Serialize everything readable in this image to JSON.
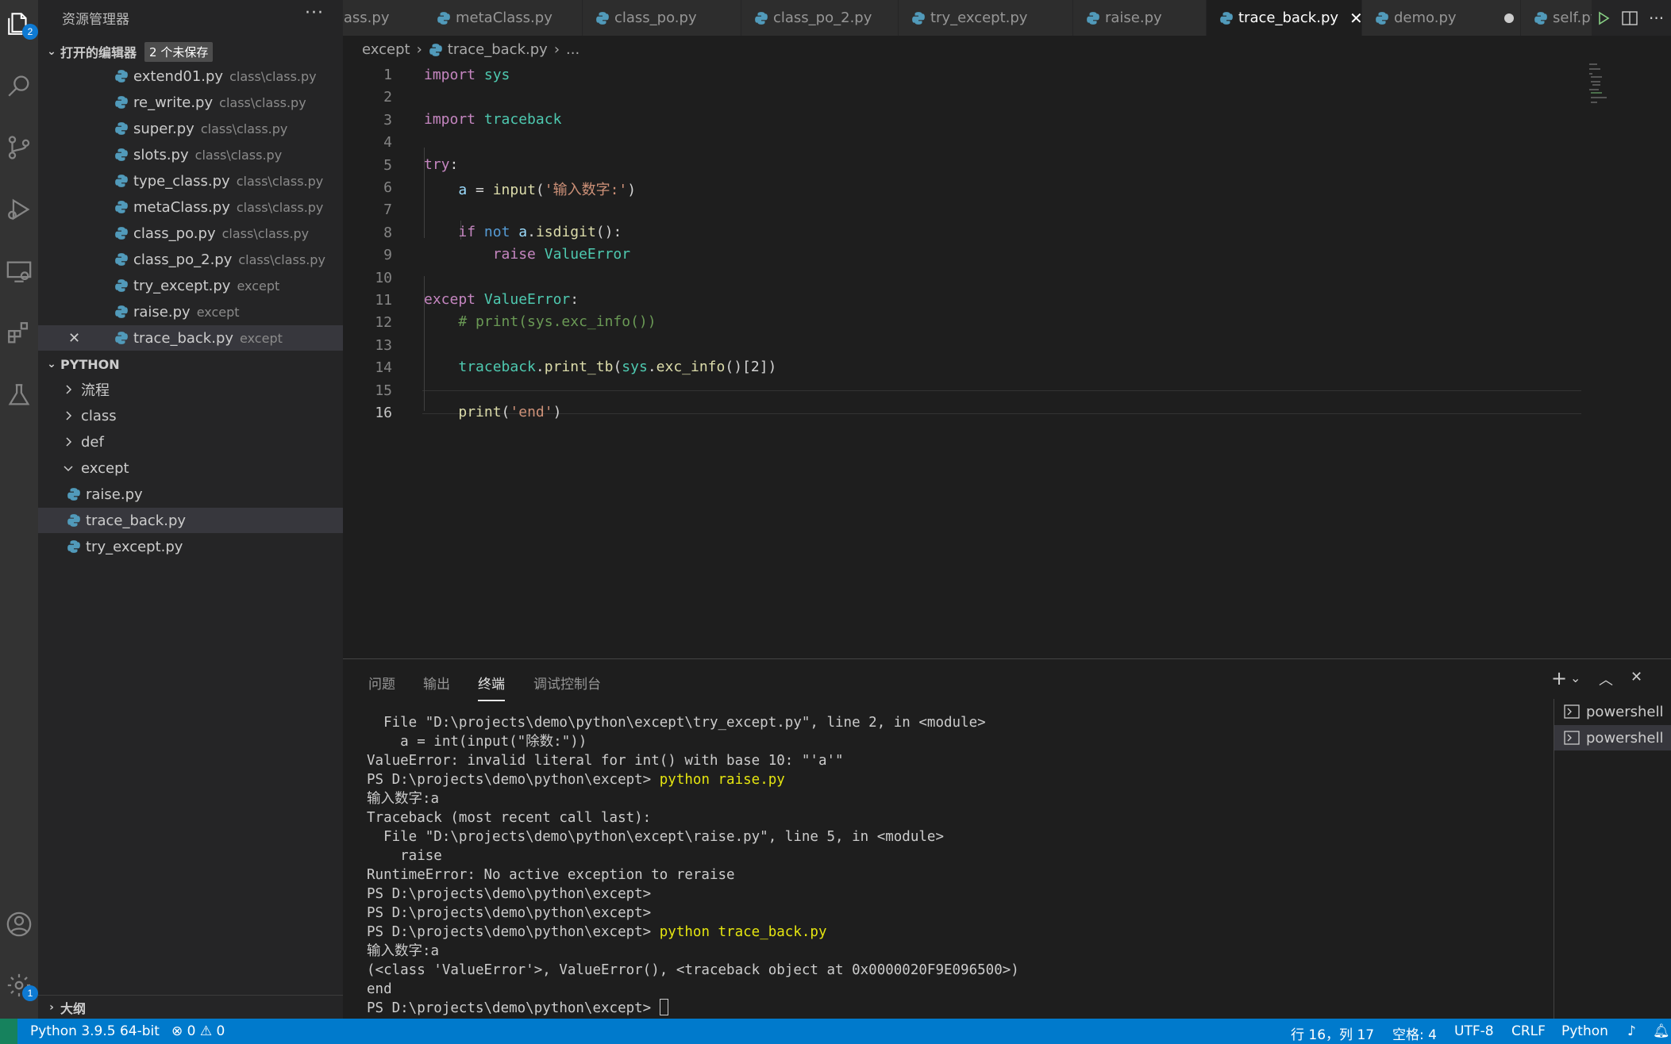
{
  "sidebar": {
    "title": "资源管理器",
    "open_editors": {
      "header": "打开的编辑器",
      "unsaved": "2 个未保存",
      "items": [
        {
          "name": "extend01.py",
          "desc": "class\\class.py"
        },
        {
          "name": "re_write.py",
          "desc": "class\\class.py"
        },
        {
          "name": "super.py",
          "desc": "class\\class.py"
        },
        {
          "name": "slots.py",
          "desc": "class\\class.py"
        },
        {
          "name": "type_class.py",
          "desc": "class\\class.py"
        },
        {
          "name": "metaClass.py",
          "desc": "class\\class.py"
        },
        {
          "name": "class_po.py",
          "desc": "class\\class.py"
        },
        {
          "name": "class_po_2.py",
          "desc": "class\\class.py"
        },
        {
          "name": "try_except.py",
          "desc": "except"
        },
        {
          "name": "raise.py",
          "desc": "except"
        },
        {
          "name": "trace_back.py",
          "desc": "except"
        }
      ]
    },
    "workspace": {
      "header": "PYTHON",
      "folders": [
        "流程",
        "class",
        "def",
        "except"
      ],
      "files": [
        "raise.py",
        "trace_back.py",
        "try_except.py"
      ]
    },
    "outline": "大纲"
  },
  "tabs": [
    {
      "label": "class.py"
    },
    {
      "label": "metaClass.py"
    },
    {
      "label": "class_po.py"
    },
    {
      "label": "class_po_2.py"
    },
    {
      "label": "try_except.py"
    },
    {
      "label": "raise.py"
    },
    {
      "label": "trace_back.py",
      "close": "✕"
    },
    {
      "label": "demo.py"
    },
    {
      "label": "self.py"
    }
  ],
  "breadcrumb": {
    "folder": "except",
    "file": "trace_back.py",
    "more": "..."
  },
  "editor": {
    "line_numbers": [
      "1",
      "2",
      "3",
      "4",
      "5",
      "6",
      "7",
      "8",
      "9",
      "10",
      "11",
      "12",
      "13",
      "14",
      "15",
      "16"
    ]
  },
  "panel": {
    "tabs": [
      "问题",
      "输出",
      "终端",
      "调试控制台"
    ],
    "terminal_lines": [
      "  File \"D:\\projects\\demo\\python\\except\\try_except.py\", line 2, in <module>",
      "    a = int(input(\"除数:\"))",
      "ValueError: invalid literal for int() with base 10: \"'a'\"",
      "PS D:\\projects\\demo\\python\\except> ",
      "输入数字:a",
      "Traceback (most recent call last):",
      "  File \"D:\\projects\\demo\\python\\except\\raise.py\", line 5, in <module>",
      "    raise",
      "RuntimeError: No active exception to reraise",
      "PS D:\\projects\\demo\\python\\except>",
      "PS D:\\projects\\demo\\python\\except>",
      "PS D:\\projects\\demo\\python\\except> ",
      "输入数字:a",
      "(<class 'ValueError'>, ValueError(), <traceback object at 0x0000020F9E096500>)",
      "end",
      "PS D:\\projects\\demo\\python\\except> "
    ],
    "cmd1": "python raise.py",
    "cmd2": "python trace_back.py",
    "terminals": [
      "powershell",
      "powershell"
    ]
  },
  "status": {
    "interpreter": "Python 3.9.5 64-bit",
    "errors": "0",
    "warnings": "0",
    "position": "行 16，列 17",
    "spaces": "空格: 4",
    "encoding": "UTF-8",
    "eol": "CRLF",
    "language": "Python"
  },
  "badges": {
    "explorer": "2",
    "settings": "1"
  },
  "colors": {
    "accent": "#007acc",
    "keyword": "#c586c0",
    "function": "#dcdcaa",
    "string": "#ce9178",
    "comment": "#6a9955"
  }
}
